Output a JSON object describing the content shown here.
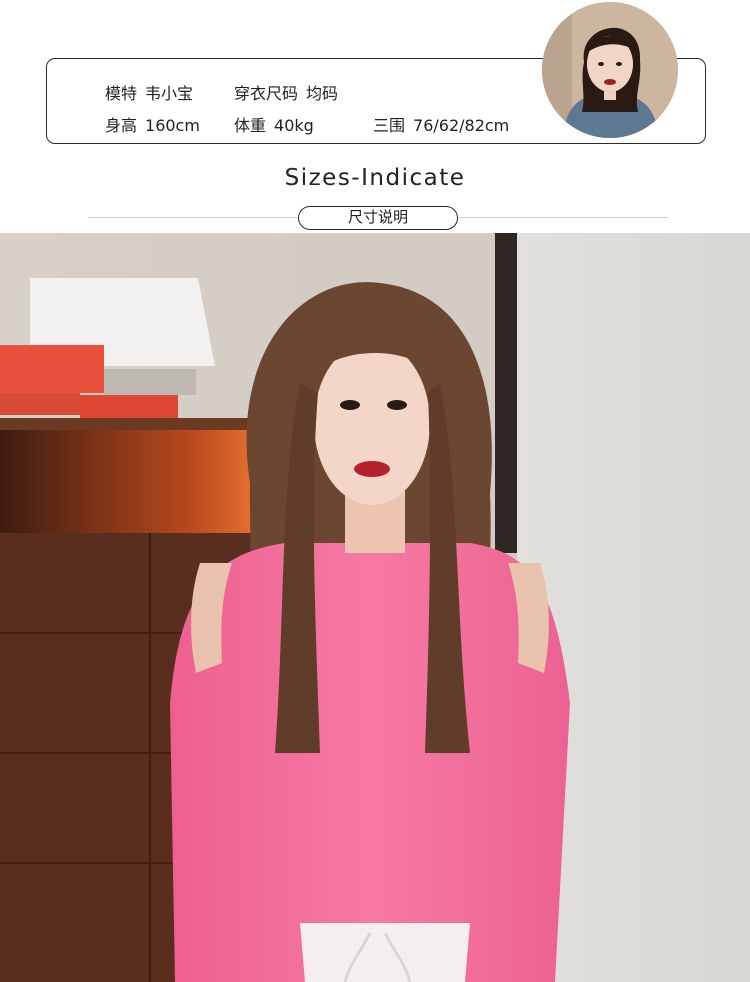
{
  "model_info": {
    "model_label": "模特",
    "model_value": "韦小宝",
    "size_label": "穿衣尺码",
    "size_value": "均码",
    "height_label": "身高",
    "height_value": "160cm",
    "weight_label": "体重",
    "weight_value": "40kg",
    "measurements_label": "三围",
    "measurements_value": "76/62/82cm"
  },
  "section": {
    "heading": "Sizes-Indicate",
    "pill_label": "尺寸说明"
  },
  "colors": {
    "top_pink": "#f46a9a",
    "wall": "#d8d4cf",
    "cabinet_wood": "#5a2e1e",
    "shelf_glow": "#e8602a",
    "hair": "#6b4630"
  }
}
